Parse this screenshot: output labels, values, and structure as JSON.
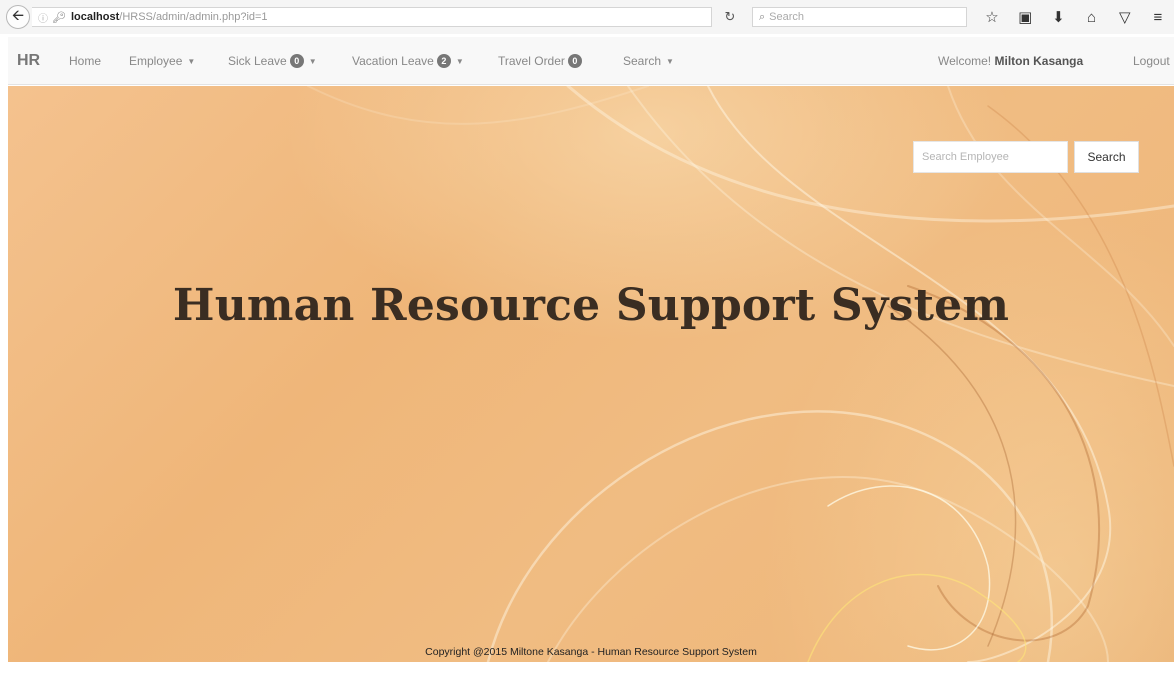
{
  "browser": {
    "url_host": "localhost",
    "url_path": "/HRSS/admin/admin.php?id=1",
    "search_placeholder": "Search",
    "icons": [
      "back-icon",
      "info-icon",
      "key-icon",
      "reload-icon",
      "search-icon",
      "star-icon",
      "clipboard-icon",
      "download-icon",
      "home-icon",
      "pocket-icon",
      "menu-icon"
    ]
  },
  "navbar": {
    "brand": "HR",
    "home": "Home",
    "employee": "Employee",
    "sick_leave": "Sick Leave",
    "sick_leave_count": "0",
    "vacation_leave": "Vacation Leave",
    "vacation_leave_count": "2",
    "travel_order": "Travel Order",
    "travel_order_count": "0",
    "search": "Search",
    "welcome_prefix": "Welcome!",
    "user_name": "Milton Kasanga",
    "logout": "Logout"
  },
  "hero": {
    "search_placeholder": "Search Employee",
    "search_button": "Search",
    "title": "Human Resource Support System",
    "copyright": "Copyright @2015 Miltone Kasanga - Human Resource Support System"
  },
  "colors": {
    "hero_background": "#efb679",
    "title_text": "#3a2d22",
    "badge": "#777777"
  }
}
